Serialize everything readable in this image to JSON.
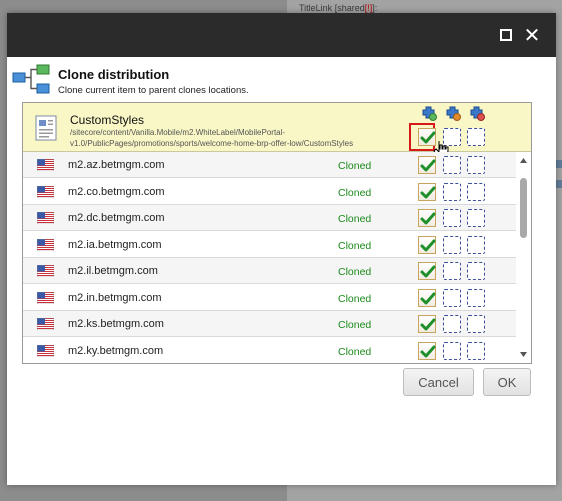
{
  "background": {
    "field_label": "TitleLink",
    "field_suffix": "[shared",
    "field_badge": "[!]",
    "field_end": "]:"
  },
  "dialog": {
    "title": "Clone distribution",
    "subtitle": "Clone current item to parent clones locations."
  },
  "item": {
    "name": "CustomStyles",
    "path": "/sitecore/content/Vanilla.Mobile/m2.WhiteLabel/MobilePortal-v1.0/PublicPages/promotions/sports/welcome-home-brp-offer-low/CustomStyles",
    "checks": [
      true,
      false,
      false
    ]
  },
  "column_icons": [
    "clone-icon",
    "clone-blue-icon",
    "clone-gray-icon"
  ],
  "sites": [
    {
      "name": "m2.az.betmgm.com",
      "status": "Cloned",
      "checks": [
        true,
        false,
        false
      ]
    },
    {
      "name": "m2.co.betmgm.com",
      "status": "Cloned",
      "checks": [
        true,
        false,
        false
      ]
    },
    {
      "name": "m2.dc.betmgm.com",
      "status": "Cloned",
      "checks": [
        true,
        false,
        false
      ]
    },
    {
      "name": "m2.ia.betmgm.com",
      "status": "Cloned",
      "checks": [
        true,
        false,
        false
      ]
    },
    {
      "name": "m2.il.betmgm.com",
      "status": "Cloned",
      "checks": [
        true,
        false,
        false
      ]
    },
    {
      "name": "m2.in.betmgm.com",
      "status": "Cloned",
      "checks": [
        true,
        false,
        false
      ]
    },
    {
      "name": "m2.ks.betmgm.com",
      "status": "Cloned",
      "checks": [
        true,
        false,
        false
      ]
    },
    {
      "name": "m2.ky.betmgm.com",
      "status": "Cloned",
      "checks": [
        true,
        false,
        false
      ]
    }
  ],
  "buttons": {
    "cancel": "Cancel",
    "ok": "OK"
  },
  "colors": {
    "titlebar": "#2b2b2b",
    "item_highlight": "#f9f7c6",
    "status_green": "#1c8a1c",
    "focus_red": "#d61a1a"
  }
}
